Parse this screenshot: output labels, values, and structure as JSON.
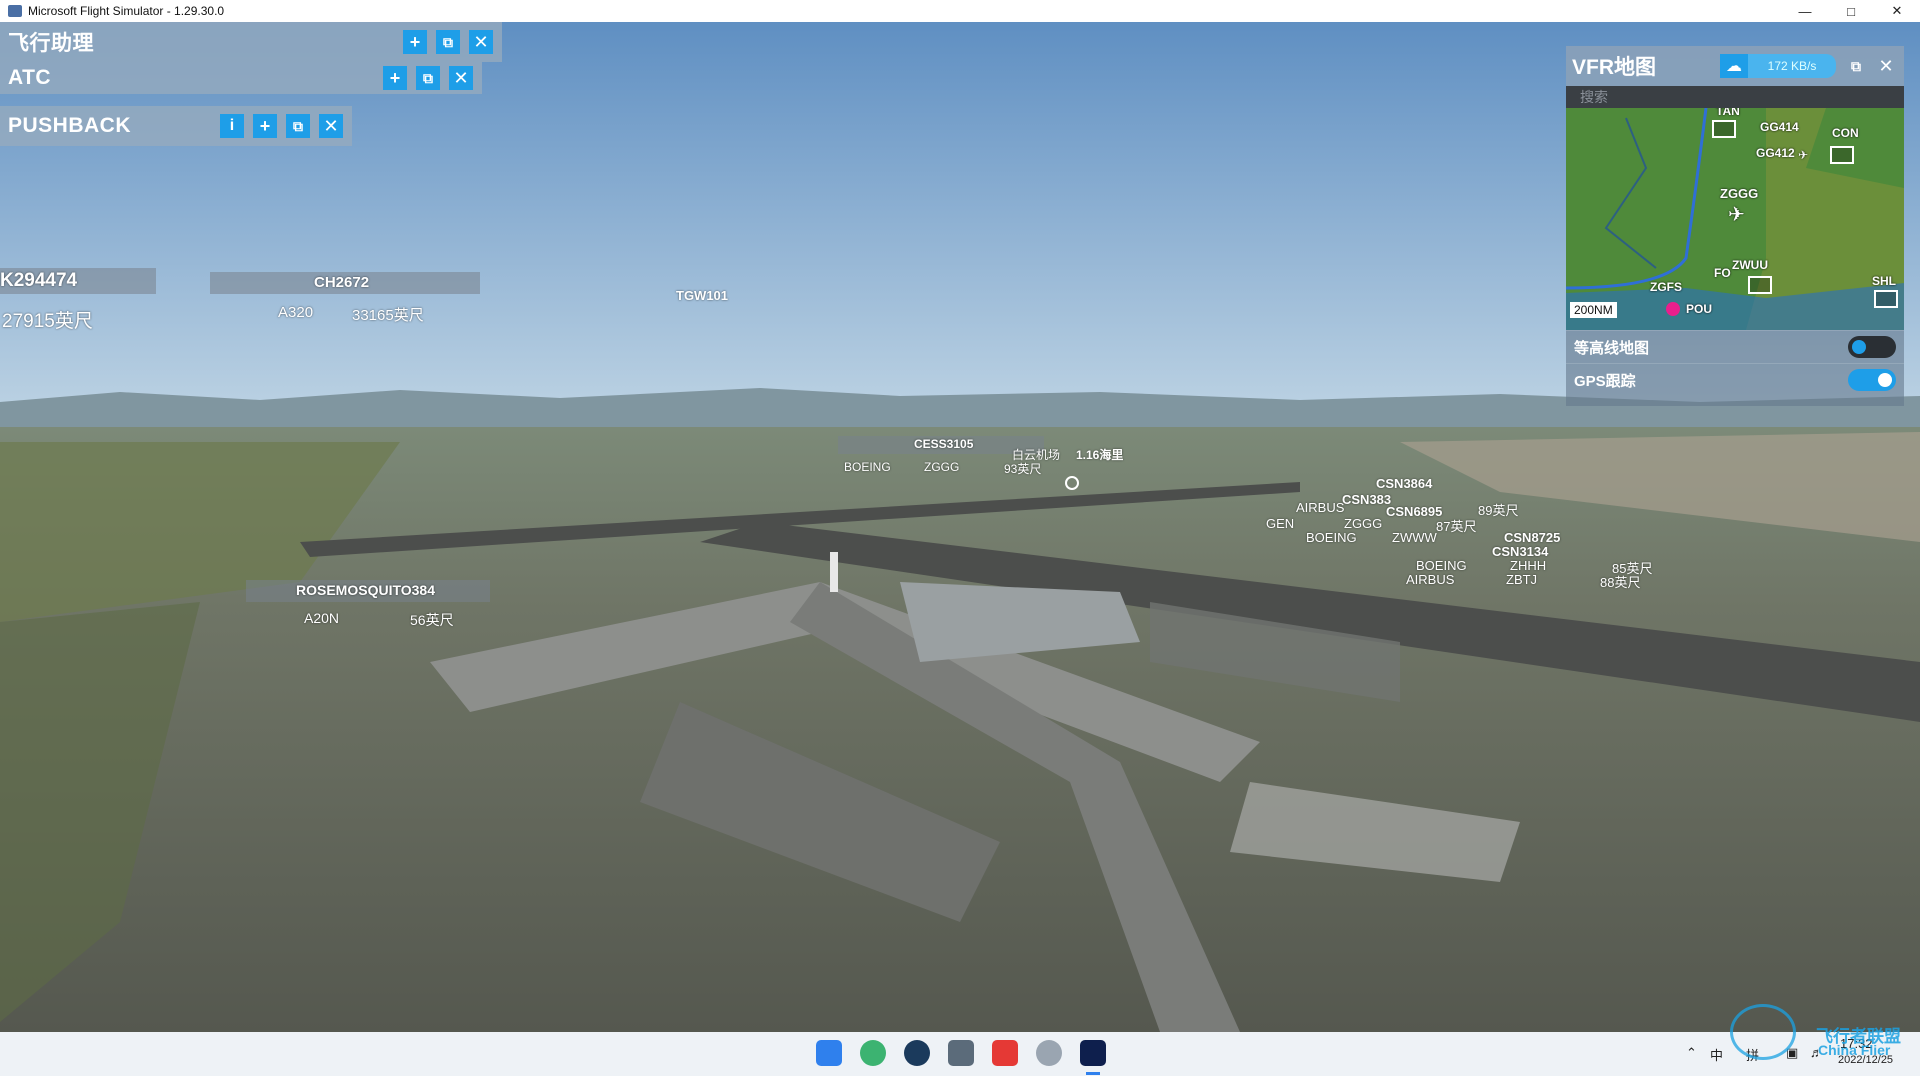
{
  "window": {
    "title": "Microsoft Flight Simulator - 1.29.30.0"
  },
  "panels": {
    "flight_assist": {
      "title": "飞行助理"
    },
    "atc": {
      "title": "ATC"
    },
    "pushback": {
      "title": "PUSHBACK",
      "info_label": "i"
    }
  },
  "vfr_map": {
    "title": "VFR地图",
    "speed": "172 KB/s",
    "search_placeholder": "搜索",
    "scale": "200NM",
    "labels": [
      "TAN",
      "GG414",
      "GG412",
      "CON",
      "ZGGG",
      "ZWUU",
      "FO",
      "ZGFS",
      "POU",
      "SHL"
    ],
    "contour_label": "等高线地图",
    "contour_on": false,
    "gps_label": "GPS跟踪",
    "gps_on": true
  },
  "traffic": [
    {
      "callsign": "K294474",
      "info": "27915英尺"
    },
    {
      "callsign": "CH2672",
      "type": "A320",
      "alt": "33165英尺"
    },
    {
      "callsign": "TGW101"
    },
    {
      "callsign": "CESS3105",
      "type": "BOEING",
      "airport": "ZGGG",
      "alt": "93英尺"
    },
    {
      "callsign": "白云机场",
      "dist": "1.16海里"
    },
    {
      "callsign": "CSN3864"
    },
    {
      "callsign": "CSN383",
      "type": "AIRBUS",
      "airport": "ZGGG"
    },
    {
      "callsign": "CSN6895",
      "alt": "89英尺",
      "alt2": "87英尺",
      "type": "BOEING",
      "airport": "ZWWW",
      "extra": "GEN"
    },
    {
      "callsign": "CSN8725",
      "alt": "85英尺"
    },
    {
      "callsign": "CSN3134",
      "type": "BOEING",
      "type2": "AIRBUS",
      "airport": "ZHHH",
      "airport2": "ZBTJ",
      "alt": "88英尺"
    },
    {
      "callsign": "ROSEMOSQUITO384",
      "type": "A20N",
      "alt": "56英尺"
    }
  ],
  "tray": {
    "ime1": "中",
    "ime2": "拼",
    "time": "17:32",
    "date": "2022/12/25"
  },
  "watermark": {
    "cn": "飞行者联盟",
    "en": "China Flier"
  }
}
